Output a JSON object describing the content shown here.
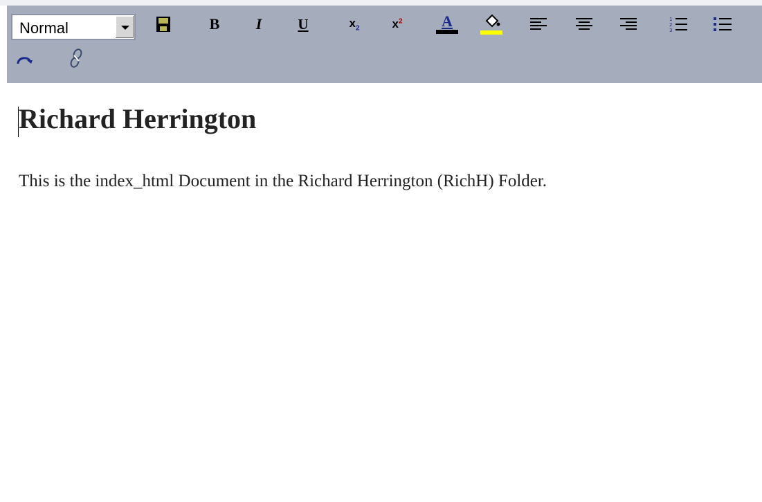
{
  "toolbar": {
    "format_select": {
      "value": "Normal"
    },
    "buttons": {
      "bold": "B",
      "italic": "I",
      "underline": "U",
      "subscript": "x₂",
      "superscript": "x²",
      "font_color": "A"
    },
    "icons": [
      "save-icon",
      "bold-icon",
      "italic-icon",
      "underline-icon",
      "subscript-icon",
      "superscript-icon",
      "font-color-icon",
      "highlight-icon",
      "align-left-icon",
      "align-center-icon",
      "align-right-icon",
      "ordered-list-icon",
      "unordered-list-icon",
      "redo-icon",
      "link-icon"
    ],
    "colors": {
      "toolbar_bg": "#a5acbc",
      "font_color_bar": "#000000",
      "highlight_bar": "#ffff00",
      "accent": "#1a2a8a"
    }
  },
  "document": {
    "heading": "Richard Herrington",
    "body": "This is the index_html Document in the Richard Herrington (RichH) Folder."
  }
}
